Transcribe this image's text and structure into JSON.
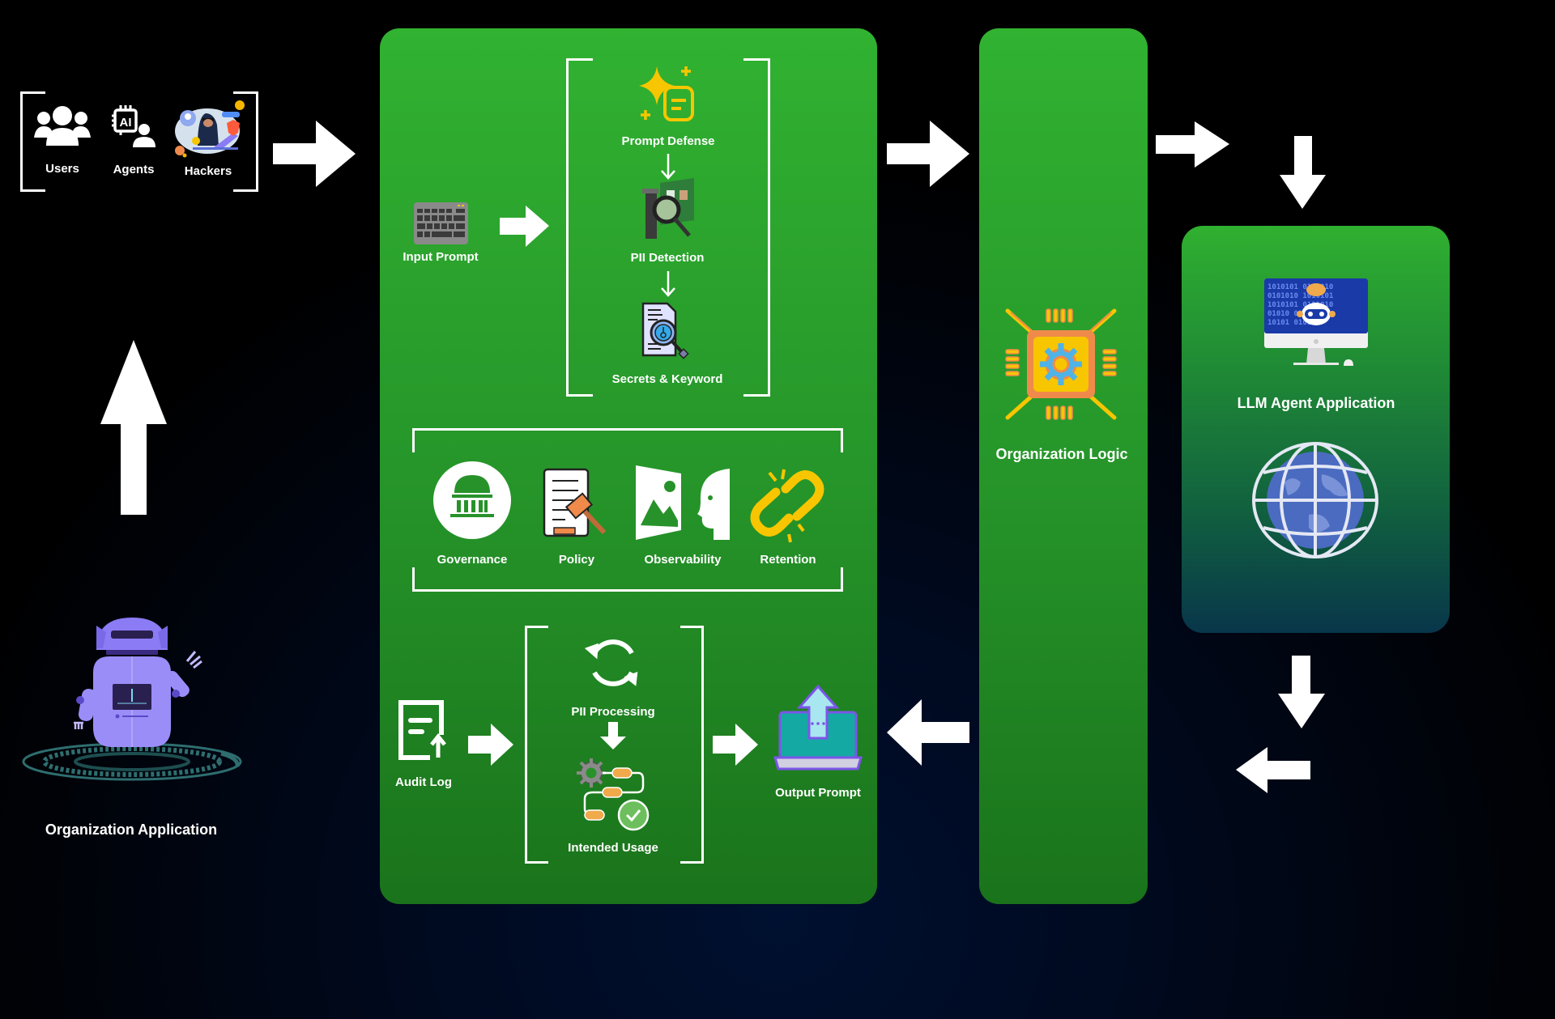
{
  "sources": {
    "items": [
      {
        "label": "Users",
        "icon": "users-icon"
      },
      {
        "label": "Agents",
        "icon": "ai-agent-icon"
      },
      {
        "label": "Hackers",
        "icon": "hacker-icon"
      }
    ]
  },
  "guard_panel": {
    "input": {
      "label": "Input Prompt",
      "icon": "keyboard-icon"
    },
    "input_checks": [
      {
        "label": "Prompt Defense",
        "icon": "sparkle-document-icon"
      },
      {
        "label": "PII Detection",
        "icon": "pii-scan-icon"
      },
      {
        "label": "Secrets & Keyword",
        "icon": "secret-search-icon"
      }
    ],
    "controls": [
      {
        "label": "Governance",
        "icon": "government-building-icon"
      },
      {
        "label": "Policy",
        "icon": "policy-gavel-icon"
      },
      {
        "label": "Observability",
        "icon": "observability-icon"
      },
      {
        "label": "Retention",
        "icon": "broken-link-icon"
      }
    ],
    "audit": {
      "label": "Audit Log",
      "icon": "audit-log-icon"
    },
    "output_checks": [
      {
        "label": "PII Processing",
        "icon": "refresh-icon"
      },
      {
        "label": "Intended Usage",
        "icon": "workflow-check-icon"
      }
    ],
    "output": {
      "label": "Output Prompt",
      "icon": "laptop-upload-icon"
    }
  },
  "org_logic": {
    "label": "Organization Logic",
    "icon": "chip-gear-icon"
  },
  "llm_app": {
    "label": "LLM Agent Application",
    "icons": [
      "ai-monitor-icon",
      "globe-icon"
    ],
    "binary_rows": [
      "1010101  0101010",
      "0101010  1010101",
      "1010101  0101010",
      "01010    0101",
      "10101    01010"
    ]
  },
  "org_app": {
    "label": "Organization Application",
    "icon": "robot-icon"
  },
  "colors": {
    "panel_green": "#31b231",
    "accent_yellow": "#f7c600",
    "arrow": "#ffffff",
    "background": "#000a20"
  }
}
